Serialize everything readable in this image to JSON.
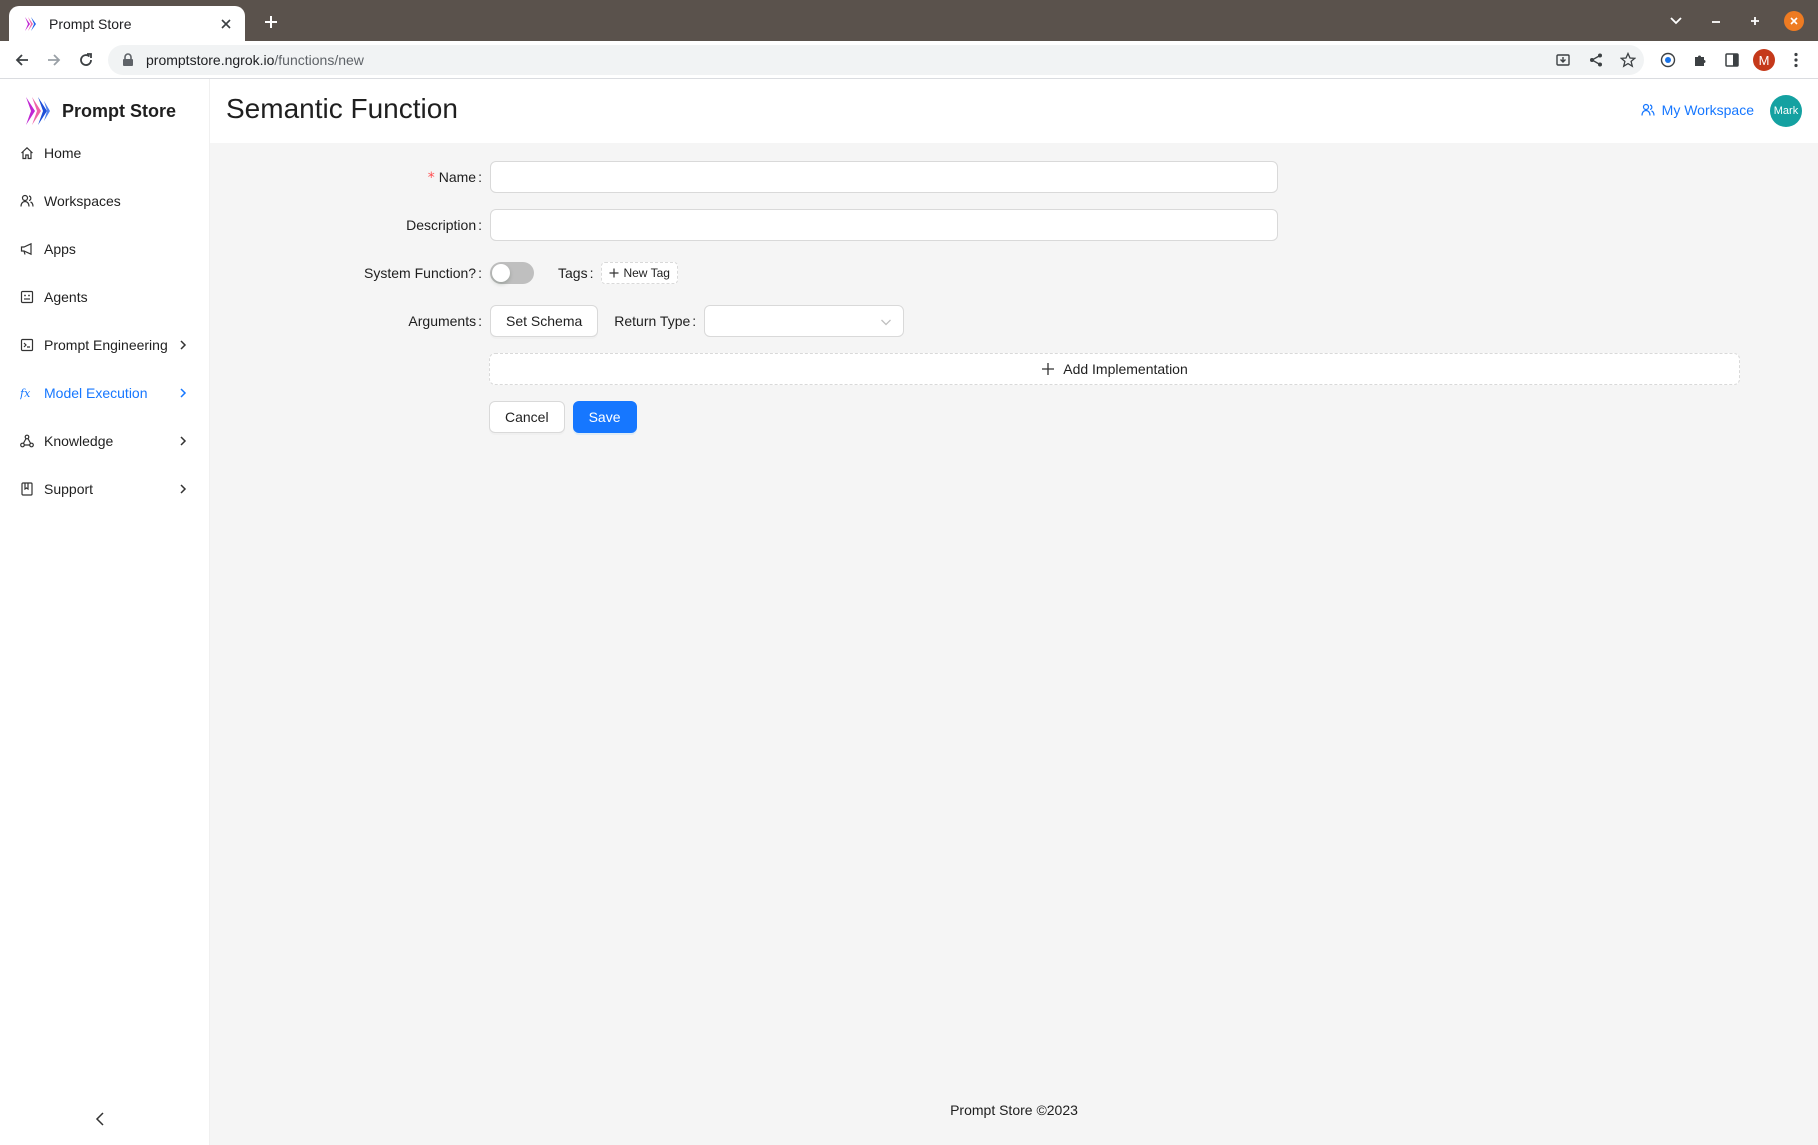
{
  "browser": {
    "tab_title": "Prompt Store",
    "url_host": "promptstore.ngrok.io",
    "url_path": "/functions/new",
    "profile_initial": "M"
  },
  "sidebar": {
    "brand": "Prompt Store",
    "items": [
      {
        "label": "Home",
        "icon": "home-icon",
        "has_submenu": false,
        "active": false
      },
      {
        "label": "Workspaces",
        "icon": "team-icon",
        "has_submenu": false,
        "active": false
      },
      {
        "label": "Apps",
        "icon": "notification-icon",
        "has_submenu": false,
        "active": false
      },
      {
        "label": "Agents",
        "icon": "robot-icon",
        "has_submenu": false,
        "active": false
      },
      {
        "label": "Prompt Engineering",
        "icon": "code-icon",
        "has_submenu": true,
        "active": false
      },
      {
        "label": "Model Execution",
        "icon": "function-icon",
        "has_submenu": true,
        "active": true
      },
      {
        "label": "Knowledge",
        "icon": "deployment-unit-icon",
        "has_submenu": true,
        "active": false
      },
      {
        "label": "Support",
        "icon": "book-icon",
        "has_submenu": true,
        "active": false
      }
    ]
  },
  "header": {
    "title": "Semantic Function",
    "workspace_label": "My Workspace",
    "user_name": "Mark"
  },
  "form": {
    "name_label": "Name",
    "name_value": "",
    "description_label": "Description",
    "description_value": "",
    "system_function_label": "System Function?",
    "system_function_on": false,
    "tags_label": "Tags",
    "new_tag_label": "New Tag",
    "arguments_label": "Arguments",
    "set_schema_label": "Set Schema",
    "return_type_label": "Return Type",
    "return_type_value": "",
    "add_implementation_label": "Add Implementation",
    "cancel_label": "Cancel",
    "save_label": "Save"
  },
  "footer": {
    "text": "Prompt Store ©2023"
  },
  "colors": {
    "primary": "#1677ff",
    "avatar": "#14a1a1",
    "required": "#ff4d4f"
  }
}
